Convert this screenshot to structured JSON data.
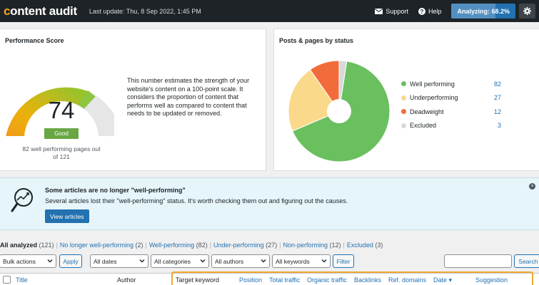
{
  "header": {
    "logo_first": "c",
    "logo_rest": "ontent audit",
    "last_update": "Last update: Thu, 8 Sep 2022, 1:45 PM",
    "support_label": "Support",
    "help_label": "Help",
    "analyzing_label": "Analyzing: 68.2%",
    "analyzing_progress": 0.682
  },
  "performance": {
    "title": "Performance Score",
    "score": "74",
    "badge": "Good",
    "pages_count": "82 well performing pages out of 121",
    "description": "This number estimates the strength of your website's content on a 100-point scale. It considers the proportion of content that performs well as compared to content that needs to be updated or removed."
  },
  "posts": {
    "title": "Posts & pages by status",
    "legend": [
      {
        "label": "Well performing",
        "value": "82",
        "color": "#6abf5e"
      },
      {
        "label": "Underperforming",
        "value": "27",
        "color": "#fbd98a"
      },
      {
        "label": "Deadweight",
        "value": "12",
        "color": "#f26b3a"
      },
      {
        "label": "Excluded",
        "value": "3",
        "color": "#d9d9d9"
      }
    ]
  },
  "notice": {
    "title": "Some articles are no longer \"well-performing\"",
    "text": "Several articles lost their \"well-performing\" status. It's worth checking them out and figuring out the causes.",
    "button": "View articles"
  },
  "views": [
    {
      "label": "All analyzed",
      "count": "(121)"
    },
    {
      "label": "No longer well-performing",
      "count": "(2)"
    },
    {
      "label": "Well-performing",
      "count": "(82)"
    },
    {
      "label": "Under-performing",
      "count": "(27)"
    },
    {
      "label": "Non-performing",
      "count": "(12)"
    },
    {
      "label": "Excluded",
      "count": "(3)"
    }
  ],
  "filters": {
    "bulk_actions": "Bulk actions",
    "apply": "Apply",
    "dates": "All dates",
    "categories": "All categories",
    "authors": "All authors",
    "keywords": "All keywords",
    "filter": "Filter",
    "search": "Search"
  },
  "table": {
    "columns": {
      "title": "Title",
      "author": "Author",
      "target_keyword": "Target keyword",
      "position": "Position",
      "total_traffic": "Total traffic",
      "organic_traffic": "Organic traffic",
      "backlinks": "Backlinks",
      "ref_domains": "Ref. domains",
      "date": "Date ▾",
      "suggestion": "Suggestion"
    }
  },
  "colors": {
    "accent": "#2271b1",
    "topbar": "#1d2327",
    "good": "#68a743",
    "highlight": "#f0a830"
  }
}
